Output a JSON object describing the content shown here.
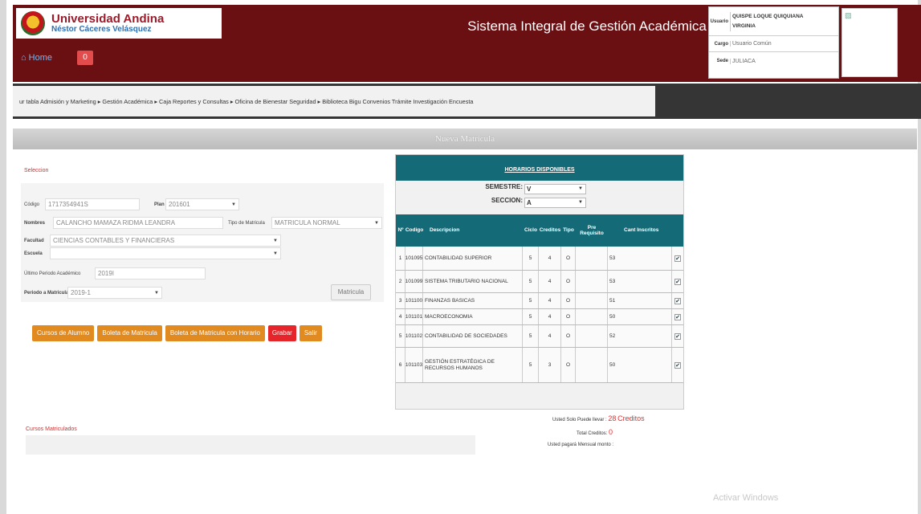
{
  "header": {
    "logo_line1": "Universidad Andina",
    "logo_line2": "Néstor Cáceres Velásquez",
    "home_label": "Home",
    "badge_label": "0",
    "system_title": "Sistema Integral de Gestión Académica",
    "user": {
      "usuario_label": "Usuario",
      "usuario_value": "QUISPE LOQUE QUIQUIANA VIRGINIA",
      "cargo_label": "Cargo",
      "cargo_value": "Usuario Común",
      "sede_label": "Sede",
      "sede_value": "JULIACA"
    }
  },
  "nav": {
    "menu_text": "ur tabla Admisión y Marketing ▸ Gestión Académica ▸ Caja Reportes y Consultas ▸ Oficina de Bienestar Seguridad ▸ Biblioteca Bigu Convenios Trámite Investigación Encuesta"
  },
  "page_title": "Nueva Matricula",
  "form": {
    "seleccion_label": "Seleccion",
    "codigo_label": "Código",
    "codigo_value": "1717354941S",
    "plan_label": "Plan",
    "plan_value": "201601",
    "nombres_label": "Nombres",
    "nombres_value": "CALANCHO MAMAZA RIDMA LEANDRA",
    "tipo_label": "Tipo de Matricula",
    "tipo_value": "MATRICULA NORMAL",
    "facultad_label": "Facultad",
    "facultad_value": "CIENCIAS CONTABLES Y FINANCIERAS",
    "escuela_label": "Escuela",
    "escuela_value": "",
    "ultimo_label": "Último Periodo Académico",
    "ultimo_value": "2019I",
    "periodo_label": "Periodo a Matricular",
    "periodo_value": "2019-1",
    "matricula_button": "Matricula",
    "buttons": [
      "Cursos de Alumno",
      "Boleta de Matricula",
      "Boleta de Matricula con Horario",
      "Grabar",
      "Salir"
    ],
    "cursos_label": "Cursos Matriculados"
  },
  "schedule": {
    "header": "HORARIOS DISPONIBLES",
    "semestre_label": "SEMESTRE:",
    "semestre_value": "V",
    "seccion_label": "SECCION:",
    "seccion_value": "A",
    "columns": [
      "Nº",
      "Codigo",
      "Descripcion",
      "Ciclo",
      "Creditos",
      "Tipo",
      "Pre Requisito",
      "Cant Inscritos"
    ],
    "rows": [
      {
        "n": "1",
        "codigo": "101095",
        "descripcion": "CONTABILIDAD SUPERIOR",
        "ciclo": "5",
        "creditos": "4",
        "tipo": "O",
        "pre": "",
        "inscritos": "53",
        "checked": "✔"
      },
      {
        "n": "2",
        "codigo": "101099",
        "descripcion": "SISTEMA TRIBUTARIO NACIONAL",
        "ciclo": "5",
        "creditos": "4",
        "tipo": "O",
        "pre": "",
        "inscritos": "53",
        "checked": "✔"
      },
      {
        "n": "3",
        "codigo": "101100",
        "descripcion": "FINANZAS BASICAS",
        "ciclo": "5",
        "creditos": "4",
        "tipo": "O",
        "pre": "",
        "inscritos": "51",
        "checked": "✔"
      },
      {
        "n": "4",
        "codigo": "101101",
        "descripcion": "MACROECONOMIA",
        "ciclo": "5",
        "creditos": "4",
        "tipo": "O",
        "pre": "",
        "inscritos": "50",
        "checked": "✔"
      },
      {
        "n": "5",
        "codigo": "101102",
        "descripcion": "CONTABILIDAD DE SOCIEDADES",
        "ciclo": "5",
        "creditos": "4",
        "tipo": "O",
        "pre": "",
        "inscritos": "52",
        "checked": "✔"
      },
      {
        "n": "6",
        "codigo": "101103",
        "descripcion": "GESTIÓN ESTRATÉGICA DE RECURSOS HUMANOS",
        "ciclo": "5",
        "creditos": "3",
        "tipo": "O",
        "pre": "",
        "inscritos": "50",
        "checked": "✔"
      }
    ]
  },
  "credits": {
    "max_label": "Usted Solo Puede llevar :",
    "max_value": "28",
    "max_unit": "Creditos",
    "total_label": "Total Creditos:",
    "total_value": "0",
    "pay_label": "Usted pagará Mensual monto :"
  },
  "watermark": "Activar Windows"
}
